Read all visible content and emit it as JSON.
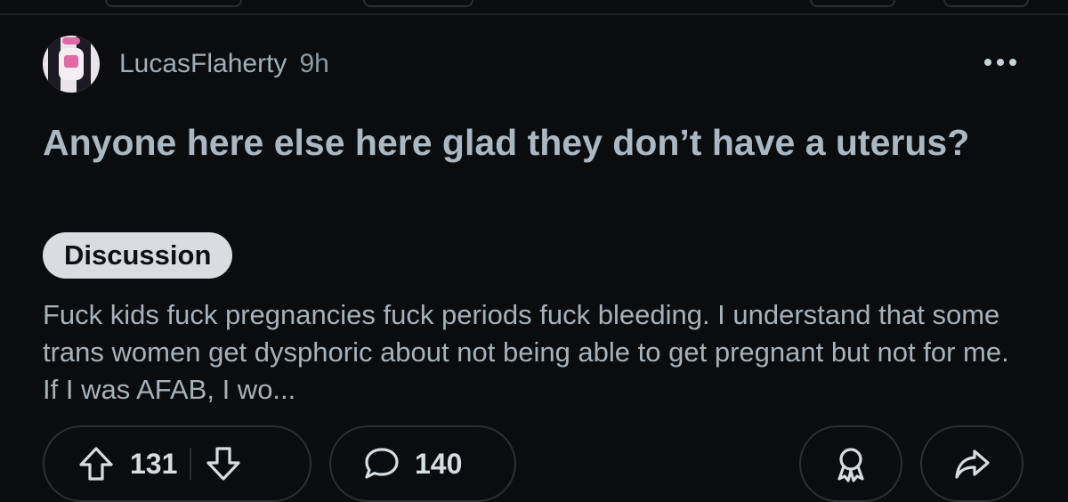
{
  "post": {
    "username": "LucasFlaherty",
    "age": "9h",
    "title": "Anyone here else here glad they don’t have a uterus?",
    "flair": "Discussion",
    "body": "Fuck kids fuck pregnancies fuck periods fuck bleeding. I understand that some trans women get dysphoric about not being able to get pregnant but not for me. If I was AFAB, I wo..."
  },
  "actions": {
    "upvotes": "131",
    "comments": "140"
  },
  "icons": [
    "more-options-icon",
    "upvote-icon",
    "downvote-icon",
    "comment-icon",
    "award-icon",
    "share-icon"
  ],
  "colors": {
    "background": "#0b0c0e",
    "title": "#a9b8c3",
    "flair_bg": "#dadde0",
    "border": "#2b3035"
  }
}
